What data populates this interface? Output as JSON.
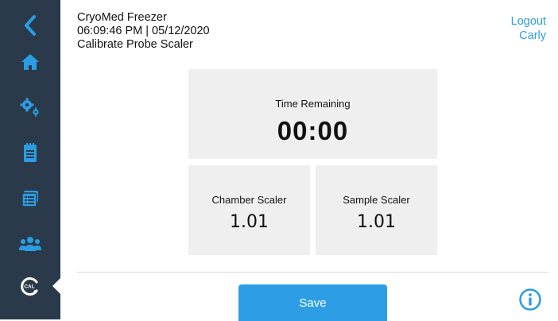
{
  "app": {
    "title": "CryoMed Freezer",
    "datetime": "06:09:46 PM | 05/12/2020",
    "page_title": "Calibrate Probe Scaler"
  },
  "user": {
    "logout_label": "Logout",
    "username": "Carly"
  },
  "sidebar": {
    "items": [
      {
        "icon": "chevron-left-icon",
        "label": "Back"
      },
      {
        "icon": "home-icon",
        "label": "Home"
      },
      {
        "icon": "gears-icon",
        "label": "Settings"
      },
      {
        "icon": "clipboard-icon",
        "label": "Logs"
      },
      {
        "icon": "list-icon",
        "label": "Events"
      },
      {
        "icon": "users-icon",
        "label": "Users"
      },
      {
        "icon": "calibrate-icon",
        "label": "CAL",
        "active": true
      }
    ]
  },
  "time_panel": {
    "label": "Time Remaining",
    "value": "00:00"
  },
  "chamber_panel": {
    "label": "Chamber Scaler",
    "value": "1.01"
  },
  "sample_panel": {
    "label": "Sample Scaler",
    "value": "1.01"
  },
  "actions": {
    "save_label": "Save",
    "info_icon": "info-icon"
  },
  "colors": {
    "sidebar": "#2b3a4a",
    "accent": "#2d9ee6",
    "link": "#2a9de2",
    "panel": "#efefef"
  }
}
